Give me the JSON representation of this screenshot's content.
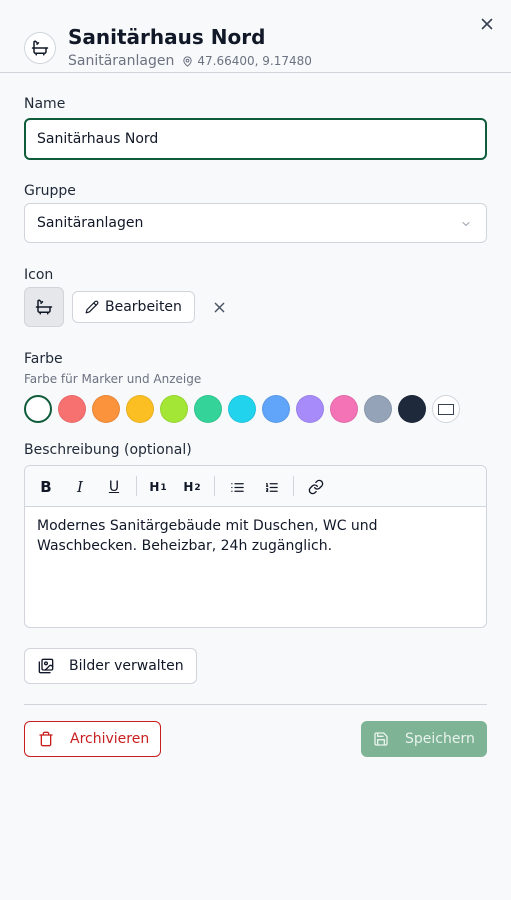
{
  "header": {
    "title": "Sanitärhaus Nord",
    "group": "Sanitäranlagen",
    "coords": "47.66400, 9.17480",
    "icon": "bathtub-icon",
    "close_icon": "close-icon",
    "pin_icon": "map-pin-icon"
  },
  "form": {
    "name_label": "Name",
    "name_value": "Sanitärhaus Nord",
    "group_label": "Gruppe",
    "group_value": "Sanitäranlagen",
    "icon_label": "Icon",
    "icon_name": "bathtub-icon",
    "edit_label": "Bearbeiten",
    "color_label": "Farbe",
    "color_hint": "Farbe für Marker und Anzeige",
    "colors": [
      "#ffffff",
      "#f87171",
      "#fb923c",
      "#fbbf24",
      "#a3e635",
      "#34d399",
      "#22d3ee",
      "#60a5fa",
      "#a78bfa",
      "#f472b6",
      "#94a3b8",
      "#1e293b"
    ],
    "selected_color": "#ffffff",
    "accent_color": "#0f5c3a",
    "description_label": "Beschreibung (optional)",
    "toolbar": {
      "bold": "B",
      "italic": "I",
      "underline": "U",
      "h1": "H",
      "h1_sub": "1",
      "h2": "H",
      "h2_sub": "2"
    },
    "description_text": "Modernes Sanitärgebäude mit Duschen, WC und Waschbecken. Beheizbar, 24h zugänglich."
  },
  "actions": {
    "images_label": "Bilder verwalten",
    "archive_label": "Archivieren",
    "save_label": "Speichern",
    "danger_color": "#c81e1e",
    "save_color": "#7fb396"
  }
}
